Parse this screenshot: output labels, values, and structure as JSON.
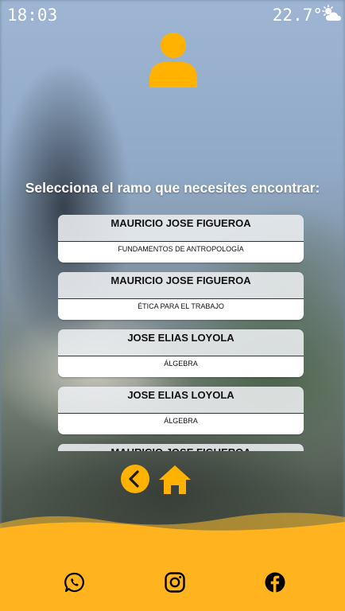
{
  "status_bar": {
    "time": "18:03",
    "temperature": "22.7°",
    "weather_icon": "partly-cloudy-icon"
  },
  "header": {
    "avatar_icon": "user-icon",
    "prompt": "Selecciona el ramo que necesites encontrar:"
  },
  "courses": [
    {
      "teacher": "MAURICIO JOSE FIGUEROA",
      "subject": "FUNDAMENTOS DE ANTROPOLOGÍA"
    },
    {
      "teacher": "MAURICIO JOSE FIGUEROA",
      "subject": "ÉTICA PARA EL TRABAJO"
    },
    {
      "teacher": "JOSE ELIAS LOYOLA",
      "subject": "ÁLGEBRA"
    },
    {
      "teacher": "JOSE ELIAS LOYOLA",
      "subject": "ÁLGEBRA"
    },
    {
      "teacher": "MAURICIO JOSE FIGUEROA",
      "subject": ""
    }
  ],
  "navigation": {
    "back_icon": "chevron-left-icon",
    "home_icon": "home-icon"
  },
  "footer": {
    "icons": [
      "whatsapp-icon",
      "instagram-icon",
      "facebook-icon"
    ]
  },
  "colors": {
    "accent": "#FFB300",
    "footer": "#FFB41F"
  }
}
